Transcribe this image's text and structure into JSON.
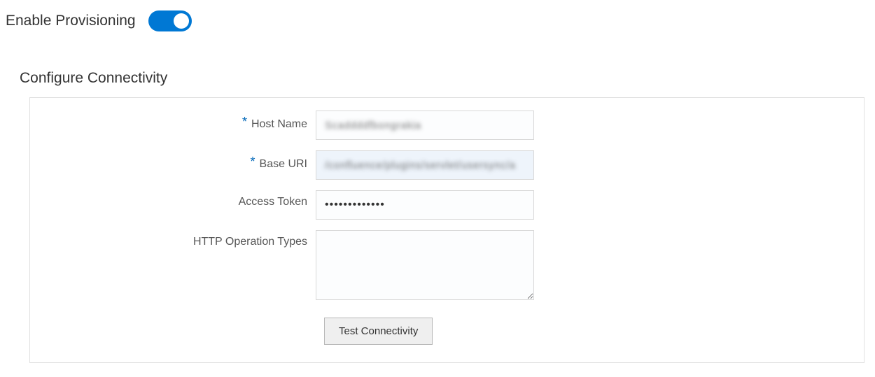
{
  "toggle": {
    "label": "Enable Provisioning",
    "enabled": true
  },
  "section": {
    "title": "Configure Connectivity"
  },
  "fields": {
    "hostName": {
      "label": "Host Name",
      "required": true,
      "value": "Scaddddfbongrakia"
    },
    "baseUri": {
      "label": "Base URI",
      "required": true,
      "value": "/confluence/plugins/servlet/usersync/a"
    },
    "accessToken": {
      "label": "Access Token",
      "required": false,
      "value": "•••••••••••••"
    },
    "httpOperationTypes": {
      "label": "HTTP Operation Types",
      "required": false,
      "value": ""
    }
  },
  "buttons": {
    "testConnectivity": "Test Connectivity"
  }
}
